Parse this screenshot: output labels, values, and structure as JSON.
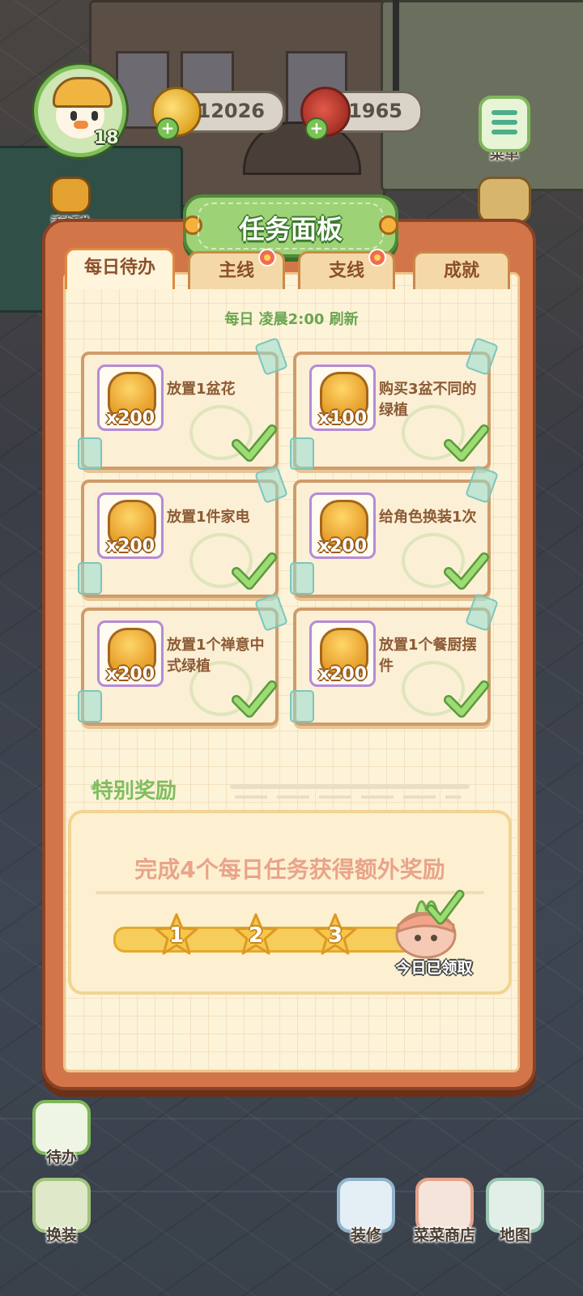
{
  "hud": {
    "level": "18",
    "coins": "12026",
    "meat": "1965",
    "plus_label": "+"
  },
  "side": {
    "menu_label": "菜单",
    "events_label": "活动汇总"
  },
  "panel": {
    "title": "任务面板",
    "tabs": [
      {
        "label": "每日待办",
        "active": true
      },
      {
        "label": "主线",
        "badge": true
      },
      {
        "label": "支线",
        "badge": true
      },
      {
        "label": "成就"
      }
    ],
    "refresh_text": "每日 凌晨2:00 刷新",
    "tasks": [
      {
        "reward": "x200",
        "desc": "放置1盆花",
        "done": true
      },
      {
        "reward": "x100",
        "desc": "购买3盆不同的绿植",
        "done": true
      },
      {
        "reward": "x200",
        "desc": "放置1件家电",
        "done": true
      },
      {
        "reward": "x200",
        "desc": "给角色换装1次",
        "done": true
      },
      {
        "reward": "x200",
        "desc": "放置1个禅意中式绿植",
        "done": true
      },
      {
        "reward": "x200",
        "desc": "放置1个餐厨摆件",
        "done": true
      }
    ],
    "special_label": "特别奖励",
    "bonus_text": "完成4个每日任务获得额外奖励",
    "milestones": [
      "1",
      "2",
      "3"
    ],
    "claimed_text": "今日已领取"
  },
  "bottom": {
    "todo": "待办",
    "dressup": "换装",
    "decorate": "装修",
    "shop": "菜菜商店",
    "map": "地图"
  },
  "colors": {
    "panel_frame": "#d2764a",
    "title_green": "#9ed276",
    "check_green": "#8fd36b"
  }
}
